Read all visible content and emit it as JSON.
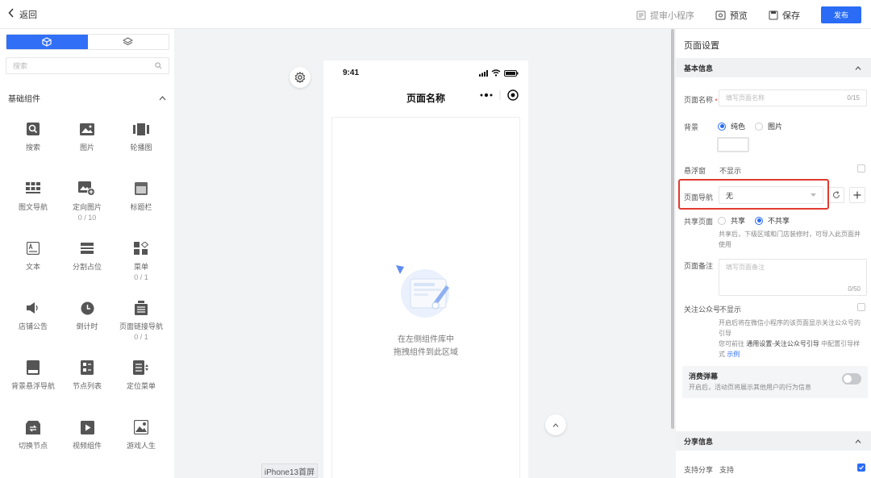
{
  "topbar": {
    "back_label": "返回",
    "review_label": "提审小程序",
    "preview_label": "预览",
    "save_label": "保存",
    "publish_label": "发布"
  },
  "left": {
    "search_placeholder": "搜索",
    "group_title": "基础组件",
    "components": [
      {
        "label": "搜索",
        "icon": "search-icon",
        "count": ""
      },
      {
        "label": "图片",
        "icon": "image-icon",
        "count": ""
      },
      {
        "label": "轮播图",
        "icon": "carousel-icon",
        "count": ""
      },
      {
        "label": "图文导航",
        "icon": "grid-nav-icon",
        "count": ""
      },
      {
        "label": "定向图片",
        "icon": "image-plus-icon",
        "count": "0 / 10"
      },
      {
        "label": "标题栏",
        "icon": "title-bar-icon",
        "count": ""
      },
      {
        "label": "文本",
        "icon": "text-icon",
        "count": ""
      },
      {
        "label": "分割占位",
        "icon": "divider-icon",
        "count": ""
      },
      {
        "label": "菜单",
        "icon": "menu-icon",
        "count": "0 / 1"
      },
      {
        "label": "店铺公告",
        "icon": "speaker-icon",
        "count": ""
      },
      {
        "label": "倒计时",
        "icon": "clock-icon",
        "count": ""
      },
      {
        "label": "页面链接导航",
        "icon": "link-nav-icon",
        "count": "0 / 1"
      },
      {
        "label": "背景悬浮导航",
        "icon": "float-nav-icon",
        "count": ""
      },
      {
        "label": "节点列表",
        "icon": "node-list-icon",
        "count": ""
      },
      {
        "label": "定位菜单",
        "icon": "locate-menu-icon",
        "count": ""
      },
      {
        "label": "切换节点",
        "icon": "switch-node-icon",
        "count": ""
      },
      {
        "label": "视频组件",
        "icon": "video-icon",
        "count": ""
      },
      {
        "label": "游戏人生",
        "icon": "game-icon",
        "count": ""
      }
    ]
  },
  "phone": {
    "time": "9:41",
    "nav_title": "页面名称",
    "empty_line1": "在左侧组件库中",
    "empty_line2": "拖拽组件到此区域",
    "device_label": "iPhone13首屏"
  },
  "settings": {
    "title": "页面设置",
    "basic_section": "基本信息",
    "page_name_label": "页面名称",
    "page_name_placeholder": "填写页面名称",
    "page_name_count": "0/15",
    "bg_label": "背景",
    "bg_opt_solid": "纯色",
    "bg_opt_image": "图片",
    "float_label": "悬浮窗",
    "float_value": "不显示",
    "nav_label": "页面导航",
    "nav_value": "无",
    "share_label": "共享页面",
    "share_opt_yes": "共享",
    "share_opt_no": "不共享",
    "share_hint": "共享后，下级区域和门店装修时，可导入此页面并",
    "share_hint2": "使用",
    "remark_label": "页面备注",
    "remark_placeholder": "填写页面备注",
    "remark_count": "0/50",
    "follow_label": "关注公众号",
    "follow_value": "不显示",
    "follow_hint1": "开启后将在微信小程序的该页面显示关注公众号的",
    "follow_hint2": "引导",
    "follow_hint3_a": "您可前往",
    "follow_hint3_b": "通用设置-关注公众号引导",
    "follow_hint3_c": "中配置引导样",
    "follow_hint4_a": "式",
    "follow_hint4_link": "示例",
    "consume_label": "消费弹幕",
    "consume_hint": "开启后，活动页将展示其他用户的行为信息",
    "share_section": "分享信息",
    "support_share_label": "支持分享",
    "support_share_value": "支持"
  },
  "colors": {
    "primary": "#2a6cf6",
    "highlight": "#e03b2f"
  }
}
